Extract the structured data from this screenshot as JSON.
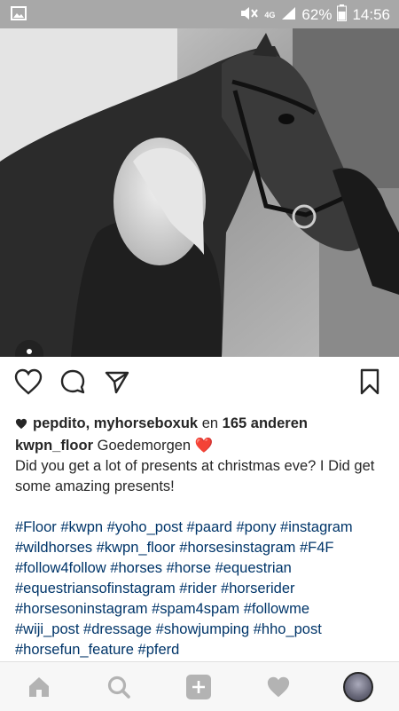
{
  "status_bar": {
    "image_icon": "image-icon",
    "mute_icon": "mute-icon",
    "network_label": "4G",
    "battery": "62%",
    "time": "14:56"
  },
  "post": {
    "photo_description_icon": "user-tag-icon",
    "actions": {
      "like_icon": "heart-icon",
      "comment_icon": "comment-icon",
      "share_icon": "direct-share-icon",
      "save_icon": "bookmark-icon"
    },
    "likes": {
      "names": "pepdito, myhorseboxuk",
      "connector": "en",
      "others": "165 anderen"
    },
    "caption": {
      "username": "kwpn_floor",
      "greeting": "Goedemorgen",
      "emoji": "❤️",
      "text": "Did you get a lot of presents at christmas eve? I Did get some amazing presents!",
      "hashtag_lines": [
        "#Floor #kwpn #yoho_post #paard #pony #instagram",
        "#wildhorses #kwpn_floor #horsesinstagram #F4F",
        "#follow4follow #horses #horse #equestrian",
        "#equestriansofinstagram #rider #horserider",
        "#horsesoninstagram #spam4spam #followme",
        "#wiji_post #dressage #showjumping #hho_post",
        "#horsefun_feature #pferd"
      ]
    }
  },
  "bottom_nav": {
    "home_icon": "home-icon",
    "search_icon": "search-icon",
    "add_icon": "add-icon",
    "activity_icon": "heart-icon",
    "profile_icon": "profile-avatar"
  },
  "colors": {
    "status_bar": "#a8a8a8",
    "hashtag": "#003569",
    "heart": "#ed2f45",
    "nav_icon": "#b3b3b3"
  }
}
